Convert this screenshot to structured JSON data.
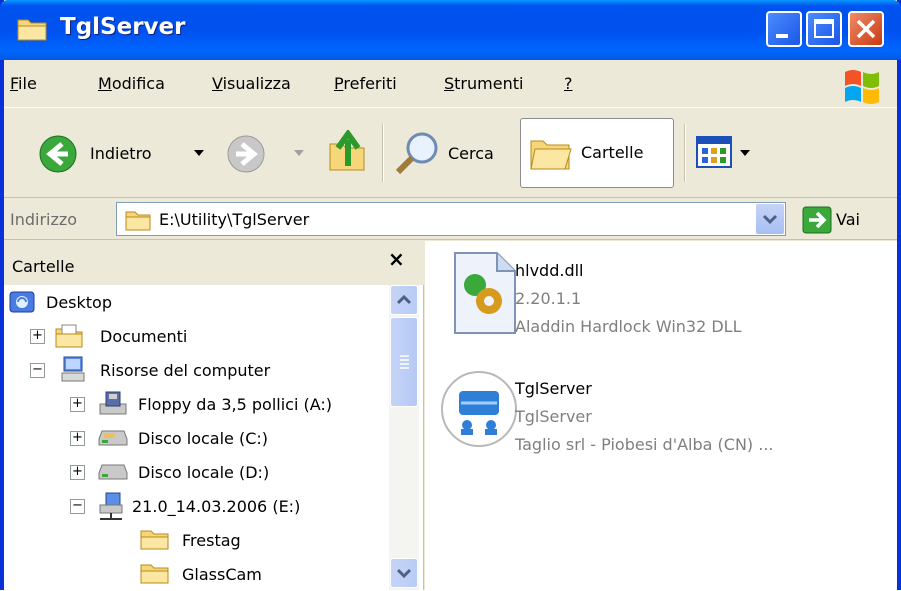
{
  "window": {
    "title": "TglServer"
  },
  "menu": {
    "items": [
      {
        "label": "File",
        "ul": "F",
        "rest": "ile"
      },
      {
        "label": "Modifica",
        "ul": "M",
        "rest": "odifica"
      },
      {
        "label": "Visualizza",
        "ul": "V",
        "rest": "isualizza"
      },
      {
        "label": "Preferiti",
        "ul": "P",
        "rest": "referiti"
      },
      {
        "label": "Strumenti",
        "ul": "S",
        "rest": "trumenti"
      },
      {
        "label": "?",
        "ul": "?",
        "rest": ""
      }
    ]
  },
  "toolbar": {
    "back_label": "Indietro",
    "search_label": "Cerca",
    "folders_label": "Cartelle"
  },
  "address": {
    "label": "Indirizzo",
    "path": "E:\\Utility\\TglServer",
    "go_label": "Vai"
  },
  "folders_pane": {
    "title": "Cartelle",
    "close": "×",
    "tree": [
      {
        "label": "Desktop",
        "icon": "desktop-icon",
        "expander": ""
      },
      {
        "label": "Documenti",
        "icon": "documents-icon",
        "expander": "+"
      },
      {
        "label": "Risorse del computer",
        "icon": "computer-icon",
        "expander": "−"
      },
      {
        "label": "Floppy da 3,5 pollici (A:)",
        "icon": "floppy-icon",
        "expander": "+"
      },
      {
        "label": "Disco locale (C:)",
        "icon": "drive-icon",
        "expander": "+"
      },
      {
        "label": "Disco locale (D:)",
        "icon": "drive-icon",
        "expander": "+"
      },
      {
        "label": "21.0_14.03.2006 (E:)",
        "icon": "network-drive-icon",
        "expander": "−"
      },
      {
        "label": "Frestag",
        "icon": "folder-icon",
        "expander": ""
      },
      {
        "label": "GlassCam",
        "icon": "folder-icon",
        "expander": ""
      }
    ]
  },
  "files": [
    {
      "name": "hlvdd.dll",
      "line2": "2.20.1.1",
      "line3": "Aladdin Hardlock Win32 DLL",
      "icon": "dll-icon"
    },
    {
      "name": "TglServer",
      "line2": "TglServer",
      "line3": "Taglio srl - Piobesi d'Alba (CN) ...",
      "icon": "app-icon"
    }
  ],
  "colors": {
    "titlebar": "#0053ee",
    "chrome": "#ece9d8",
    "close_button": "#c83a12"
  }
}
